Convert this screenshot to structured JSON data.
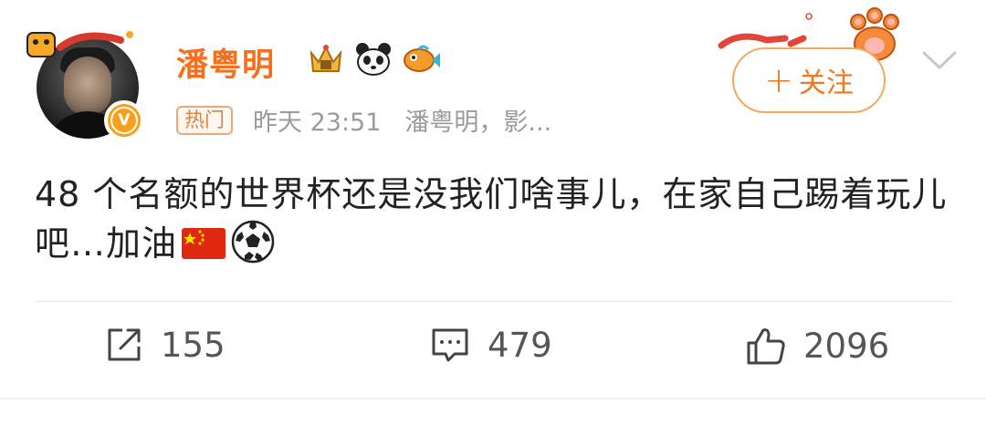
{
  "post": {
    "author": "潘粤明",
    "badges": [
      "crown-badge-icon",
      "panda-badge-icon",
      "fish-badge-icon"
    ],
    "hot_tag": "热门",
    "time": "昨天 23:51",
    "source": "潘粤明，影...",
    "follow_label": "关注",
    "follow_plus": "+",
    "verified_badge": "V",
    "content_text": "48 个名额的世界杯还是没我们啥事儿，在家自己踢着玩儿吧…加油",
    "content_emojis": [
      "china-flag-emoji",
      "soccer-ball-emoji"
    ]
  },
  "actions": {
    "repost_count": "155",
    "comment_count": "479",
    "like_count": "2096"
  },
  "colors": {
    "author": "#f76f1b",
    "accent": "#f3771b",
    "meta_gray": "#9b9b9b",
    "text": "#222222"
  }
}
